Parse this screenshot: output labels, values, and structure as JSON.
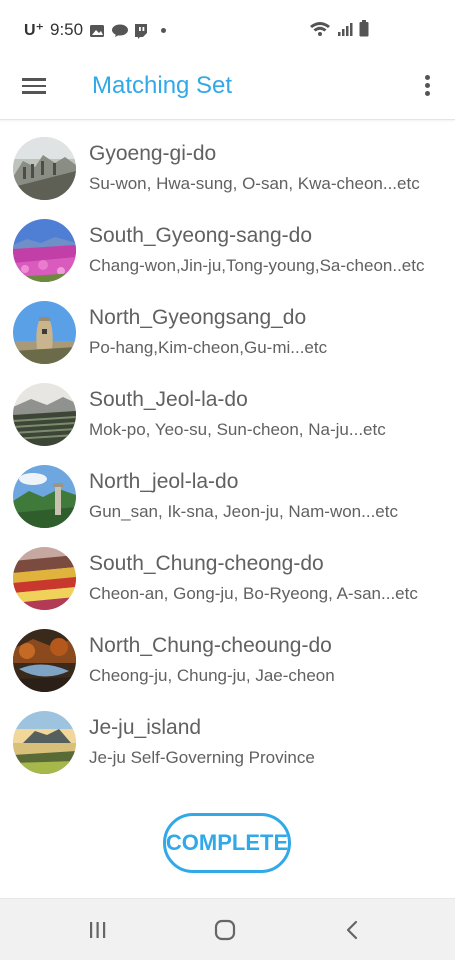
{
  "status_bar": {
    "carrier": "U⁺",
    "time": "9:50"
  },
  "app_bar": {
    "title": "Matching Set"
  },
  "regions": [
    {
      "title": "Gyoeng-gi-do",
      "subtitle": "Su-won, Hwa-sung, O-san, Kwa-cheon...etc"
    },
    {
      "title": "South_Gyeong-sang-do",
      "subtitle": "Chang-won,Jin-ju,Tong-young,Sa-cheon..etc"
    },
    {
      "title": "North_Gyeongsang_do",
      "subtitle": "Po-hang,Kim-cheon,Gu-mi...etc"
    },
    {
      "title": "South_Jeol-la-do",
      "subtitle": "Mok-po, Yeo-su, Sun-cheon, Na-ju...etc"
    },
    {
      "title": "North_jeol-la-do",
      "subtitle": "Gun_san, Ik-sna, Jeon-ju, Nam-won...etc"
    },
    {
      "title": "South_Chung-cheong-do",
      "subtitle": "Cheon-an, Gong-ju, Bo-Ryeong, A-san...etc"
    },
    {
      "title": "North_Chung-cheoung-do",
      "subtitle": "Cheong-ju, Chung-ju, Jae-cheon"
    },
    {
      "title": "Je-ju_island",
      "subtitle": "Je-ju Self-Governing Province"
    }
  ],
  "complete_button": {
    "label": "COMPLETE"
  },
  "colors": {
    "accent": "#31a9e8",
    "text": "#616161",
    "nav_bar": "#f1f1f1"
  }
}
